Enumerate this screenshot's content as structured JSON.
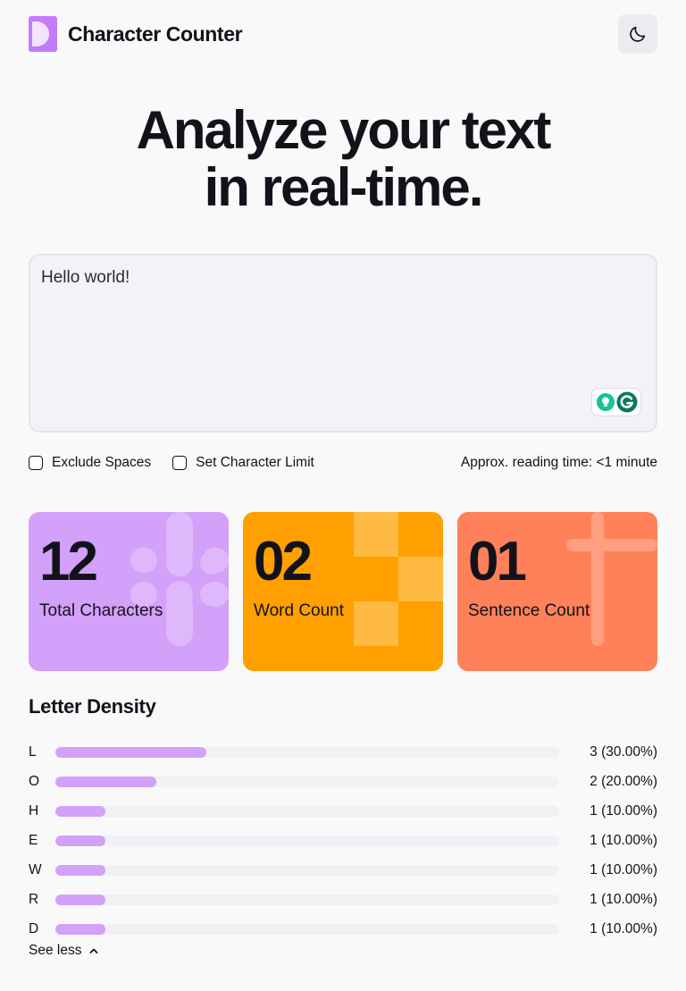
{
  "header": {
    "app_name": "Character Counter",
    "theme_toggle_icon": "moon-icon"
  },
  "hero": {
    "line1": "Analyze your text",
    "line2": "in real-time."
  },
  "editor": {
    "value": "Hello world!",
    "widget_icons": [
      "lightbulb-icon",
      "grammarly-icon"
    ]
  },
  "options": {
    "exclude_spaces": {
      "label": "Exclude Spaces",
      "checked": false
    },
    "char_limit": {
      "label": "Set Character Limit",
      "checked": false
    },
    "reading_time": "Approx. reading time: <1 minute"
  },
  "stats": [
    {
      "value": "12",
      "label": "Total Characters",
      "color": "#d3a0fa"
    },
    {
      "value": "02",
      "label": "Word Count",
      "color": "#ff9f00"
    },
    {
      "value": "01",
      "label": "Sentence Count",
      "color": "#fe8159"
    }
  ],
  "density": {
    "title": "Letter Density",
    "accent": "#d3a0fa",
    "rows": [
      {
        "letter": "L",
        "count": "3 (30.00%)",
        "fraction": 0.3
      },
      {
        "letter": "O",
        "count": "2 (20.00%)",
        "fraction": 0.2
      },
      {
        "letter": "H",
        "count": "1 (10.00%)",
        "fraction": 0.1
      },
      {
        "letter": "E",
        "count": "1 (10.00%)",
        "fraction": 0.1
      },
      {
        "letter": "W",
        "count": "1 (10.00%)",
        "fraction": 0.1
      },
      {
        "letter": "R",
        "count": "1 (10.00%)",
        "fraction": 0.1
      },
      {
        "letter": "D",
        "count": "1 (10.00%)",
        "fraction": 0.1
      }
    ],
    "toggle_label": "See less",
    "toggle_icon": "chevron-up-icon"
  }
}
